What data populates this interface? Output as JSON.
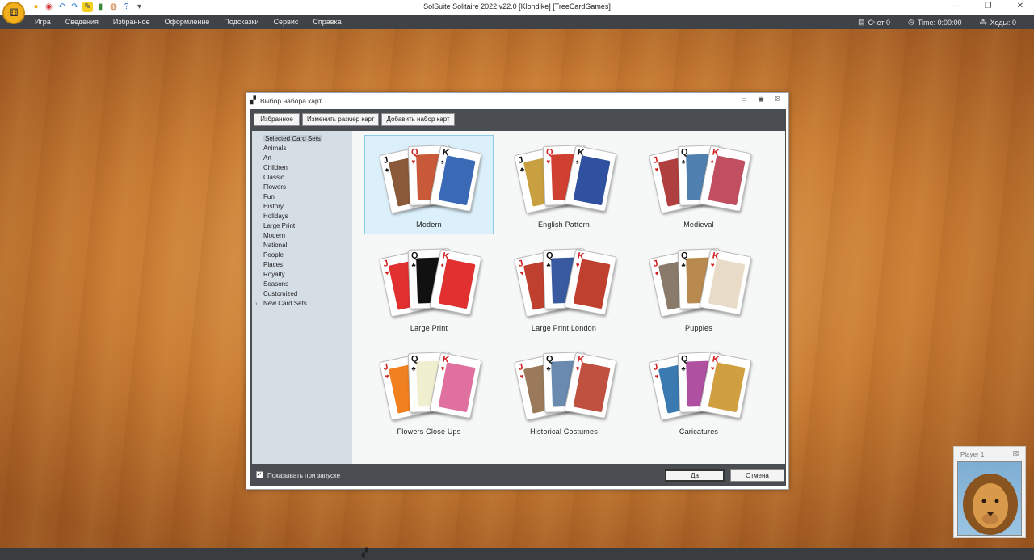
{
  "window": {
    "title": "SolSuite Solitaire 2022 v22.0  [Klondike]  [TreeCardGames]",
    "logo_glyph": "⚅",
    "controls": [
      "—",
      "❐",
      "✕"
    ]
  },
  "quickbar": [
    {
      "name": "new-game-icon",
      "glyph": "●",
      "color": "#f2b01e"
    },
    {
      "name": "record-icon",
      "glyph": "◉",
      "color": "#d23030"
    },
    {
      "name": "undo-icon",
      "glyph": "↶",
      "color": "#1e6fd0"
    },
    {
      "name": "redo-icon",
      "glyph": "↷",
      "color": "#1e6fd0"
    },
    {
      "name": "edit-icon",
      "glyph": "✎",
      "color": "#444"
    },
    {
      "name": "stats-icon",
      "glyph": "▮",
      "color": "#3a8a3a"
    },
    {
      "name": "palette-icon",
      "glyph": "◍",
      "color": "#c86a20"
    },
    {
      "name": "help-icon",
      "glyph": "?",
      "color": "#1e6fd0"
    },
    {
      "name": "more-icon",
      "glyph": "▾",
      "color": "#555"
    }
  ],
  "menu": [
    "Игра",
    "Сведения",
    "Избранное",
    "Оформление",
    "Подсказки",
    "Сервис",
    "Справка"
  ],
  "status": {
    "score": "Счет 0",
    "time": "Time: 0:00:00",
    "moves": "Ходы: 0"
  },
  "dialog": {
    "title": "Выбор набора карт",
    "toolbar": {
      "favorites": "Избранное",
      "resize": "Изменить размер карт",
      "add": "Добавить набор карт"
    },
    "categories": [
      "Selected Card Sets",
      "Animals",
      "Art",
      "Children",
      "Classic",
      "Flowers",
      "Fun",
      "History",
      "Holidays",
      "Large Print",
      "Modern",
      "National",
      "People",
      "Places",
      "Royalty",
      "Seasons",
      "Customized",
      "New Card Sets"
    ],
    "selected_category_index": 0,
    "card_sets": [
      {
        "label": "Modern",
        "suits": [
          "♠",
          "♥",
          "♠"
        ],
        "face_colors": [
          "#8a5a3a",
          "#c85a3a",
          "#3a6ab5"
        ]
      },
      {
        "label": "English Pattern",
        "suits": [
          "♣",
          "♥",
          "♠"
        ],
        "face_colors": [
          "#c8a040",
          "#d04030",
          "#3050a0"
        ]
      },
      {
        "label": "Medieval",
        "suits": [
          "♥",
          "♣",
          "♦"
        ],
        "face_colors": [
          "#b04040",
          "#5080b0",
          "#c05060"
        ]
      },
      {
        "label": "Large Print",
        "suits": [
          "♥",
          "♣",
          "♦"
        ],
        "face_colors": [
          "#e03030",
          "#111111",
          "#e03030"
        ]
      },
      {
        "label": "Large Print London",
        "suits": [
          "♥",
          "♣",
          "♥"
        ],
        "face_colors": [
          "#c04030",
          "#3a5aa0",
          "#c04030"
        ]
      },
      {
        "label": "Puppies",
        "suits": [
          "♦",
          "♣",
          "♥"
        ],
        "face_colors": [
          "#8a7a6a",
          "#b88a50",
          "#e8dcc8"
        ]
      },
      {
        "label": "Flowers Close Ups",
        "suits": [
          "♥",
          "♣",
          "♥"
        ],
        "face_colors": [
          "#f08020",
          "#f0f0d0",
          "#e070a0"
        ]
      },
      {
        "label": "Historical Costumes",
        "suits": [
          "♥",
          "♣",
          "♥"
        ],
        "face_colors": [
          "#9a7a5a",
          "#6a8ab0",
          "#c05040"
        ]
      },
      {
        "label": "Caricatures",
        "suits": [
          "♥",
          "♣",
          "♥"
        ],
        "face_colors": [
          "#3a7ab0",
          "#b050a0",
          "#d0a040"
        ]
      }
    ],
    "selected_set_index": 0,
    "ranks": [
      "J",
      "Q",
      "K"
    ],
    "footer": {
      "show_on_startup": "Показывать при запуске",
      "ok": "Да",
      "cancel": "Отмена"
    }
  },
  "player": {
    "name": "Player 1"
  }
}
